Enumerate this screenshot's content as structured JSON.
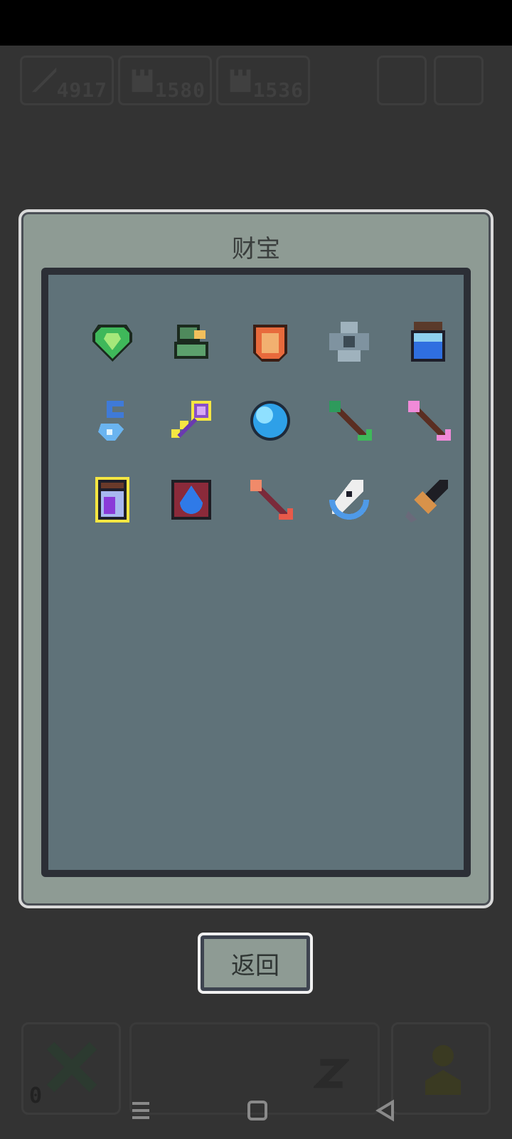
{
  "hud": {
    "resources": [
      {
        "name": "weapon-power",
        "value": "4917"
      },
      {
        "name": "castle-a",
        "value": "1580"
      },
      {
        "name": "castle-b",
        "value": "1536"
      }
    ]
  },
  "dialog": {
    "title": "财宝",
    "items": [
      {
        "icon": "green-gem-icon",
        "highlighted": false
      },
      {
        "icon": "green-helmet-icon",
        "highlighted": false
      },
      {
        "icon": "orange-armor-icon",
        "highlighted": false
      },
      {
        "icon": "stone-totem-icon",
        "highlighted": false
      },
      {
        "icon": "blue-jar-icon",
        "highlighted": false
      },
      {
        "icon": "blue-crystal-charm-icon",
        "highlighted": false
      },
      {
        "icon": "purple-key-icon",
        "highlighted": true
      },
      {
        "icon": "blue-orb-icon",
        "highlighted": false
      },
      {
        "icon": "green-arrow-icon",
        "highlighted": false
      },
      {
        "icon": "pink-arrow-icon",
        "highlighted": false
      },
      {
        "icon": "purple-potion-jar-icon",
        "highlighted": true
      },
      {
        "icon": "blue-flame-box-icon",
        "highlighted": false
      },
      {
        "icon": "red-arrow-icon",
        "highlighted": false
      },
      {
        "icon": "white-anchor-icon",
        "highlighted": false
      },
      {
        "icon": "bronze-blade-icon",
        "highlighted": false
      }
    ]
  },
  "back_button": {
    "label": "返回"
  },
  "bottom": {
    "left_count": "0"
  },
  "navbar": {
    "items": [
      "menu-icon",
      "home-icon",
      "back-icon"
    ]
  },
  "colors": {
    "background": "#333333",
    "dialog": "#8e9b94",
    "panel": "#5f7279",
    "highlight": "#f5e642"
  }
}
